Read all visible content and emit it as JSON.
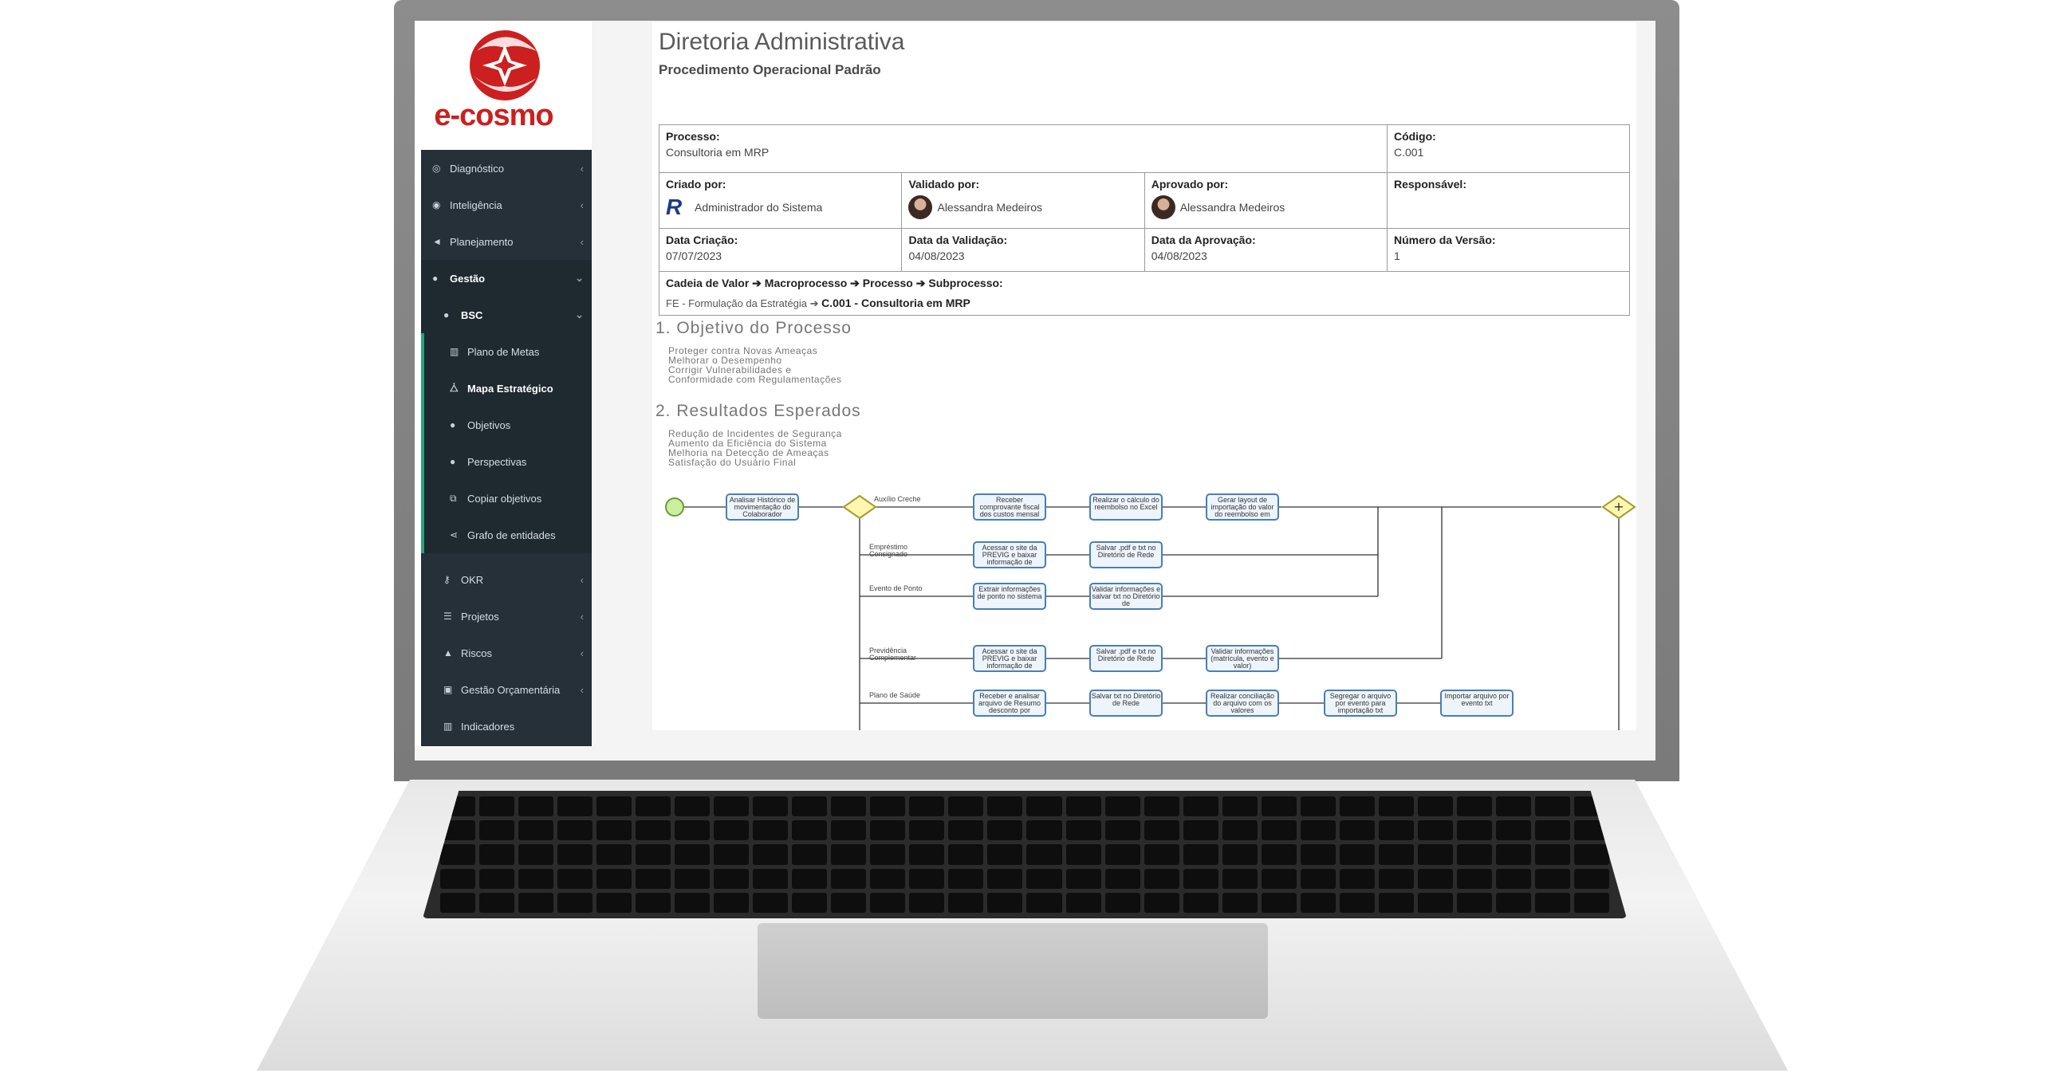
{
  "brand": {
    "name": "e-cosmo"
  },
  "sidebar": {
    "items": [
      {
        "label": "Diagnóstico",
        "icon": "target-icon"
      },
      {
        "label": "Inteligência",
        "icon": "eye-icon"
      },
      {
        "label": "Planejamento",
        "icon": "megaphone-icon"
      },
      {
        "label": "Gestão",
        "icon": "globe-icon"
      },
      {
        "label": "BSC",
        "icon": "globe-icon"
      },
      {
        "label": "Plano de Metas",
        "icon": "chart-icon"
      },
      {
        "label": "Mapa Estratégico",
        "icon": "sitemap-icon"
      },
      {
        "label": "Objetivos",
        "icon": "circle-icon"
      },
      {
        "label": "Perspectivas",
        "icon": "circle-icon"
      },
      {
        "label": "Copiar objetivos",
        "icon": "copy-icon"
      },
      {
        "label": "Grafo de entidades",
        "icon": "share-icon"
      },
      {
        "label": "OKR",
        "icon": "key-icon"
      },
      {
        "label": "Projetos",
        "icon": "list-icon"
      },
      {
        "label": "Riscos",
        "icon": "warning-icon"
      },
      {
        "label": "Gestão Orçamentária",
        "icon": "money-icon"
      },
      {
        "label": "Indicadores",
        "icon": "chart-icon"
      }
    ]
  },
  "document": {
    "title": "Diretoria Administrativa",
    "subtitle": "Procedimento Operacional Padrão",
    "processo_label": "Processo:",
    "processo_value": "Consultoria em MRP",
    "codigo_label": "Código:",
    "codigo_value": "C.001",
    "criado_label": "Criado por:",
    "criado_value": "Administrador do Sistema",
    "validado_label": "Validado por:",
    "validado_value": "Alessandra Medeiros",
    "aprovado_label": "Aprovado por:",
    "aprovado_value": "Alessandra Medeiros",
    "responsavel_label": "Responsável:",
    "data_criacao_label": "Data Criação:",
    "data_criacao_value": "07/07/2023",
    "data_validacao_label": "Data da Validação:",
    "data_validacao_value": "04/08/2023",
    "data_aprovacao_label": "Data da Aprovação:",
    "data_aprovacao_value": "04/08/2023",
    "versao_label": "Número da Versão:",
    "versao_value": "1",
    "cadeia": {
      "header": [
        "Cadeia de Valor",
        "Macroprocesso",
        "Processo",
        "Subprocesso:"
      ],
      "origin": "FE - Formulação da Estratégia",
      "target": "C.001 - Consultoria em MRP"
    },
    "section1_title": "1. Objetivo do Processo",
    "section1_items": [
      "Proteger contra Novas Ameaças",
      "Melhorar o Desempenho",
      "Corrigir Vulnerabilidades e",
      "Conformidade com Regulamentações"
    ],
    "section2_title": "2. Resultados Esperados",
    "section2_items": [
      "Redução de Incidentes de Segurança",
      "Aumento da Eficiência do Sistema",
      "Melhoria na Detecção de Ameaças",
      "Satisfação do Usuário Final"
    ]
  },
  "flow": {
    "start_task": "Analisar Histórico de movimentação do Colaborador",
    "lanes": [
      {
        "label": "Auxílio Creche",
        "tasks": [
          "Receber comprovante fiscal dos custos mensal",
          "Realizar o cálculo do reembolso no Excel",
          "Gerar layout de importação do valor do reembolso em"
        ]
      },
      {
        "label": "Empréstimo Consignado",
        "tasks": [
          "Acessar o site da PREVIG e baixar informação de",
          "Salvar .pdf e txt no Diretório de Rede"
        ]
      },
      {
        "label": "Evento de Ponto",
        "tasks": [
          "Extrair informações de ponto no sistema",
          "Validar informações e salvar txt no Diretório de"
        ]
      },
      {
        "label": "Previdência Complementar",
        "tasks": [
          "Acessar o site da PREVIG e baixar informação de",
          "Salvar .pdf e txt no Diretório de Rede",
          "Validar informações (matrícula, evento e valor)"
        ]
      },
      {
        "label": "Plano de Saúde",
        "tasks": [
          "Receber e analisar arquivo de Resumo desconto por",
          "Salvar txt no Diretório de Rede",
          "Realizar conciliação do arquivo com os valores",
          "Segregar o arquivo por evento para importação txt",
          "Importar arquivo por evento txt"
        ]
      }
    ]
  },
  "colors": {
    "sidebar_bg": "#253039",
    "accent": "#27a37a",
    "brand": "#cc1f1f",
    "task_border": "#4a7fb5"
  }
}
